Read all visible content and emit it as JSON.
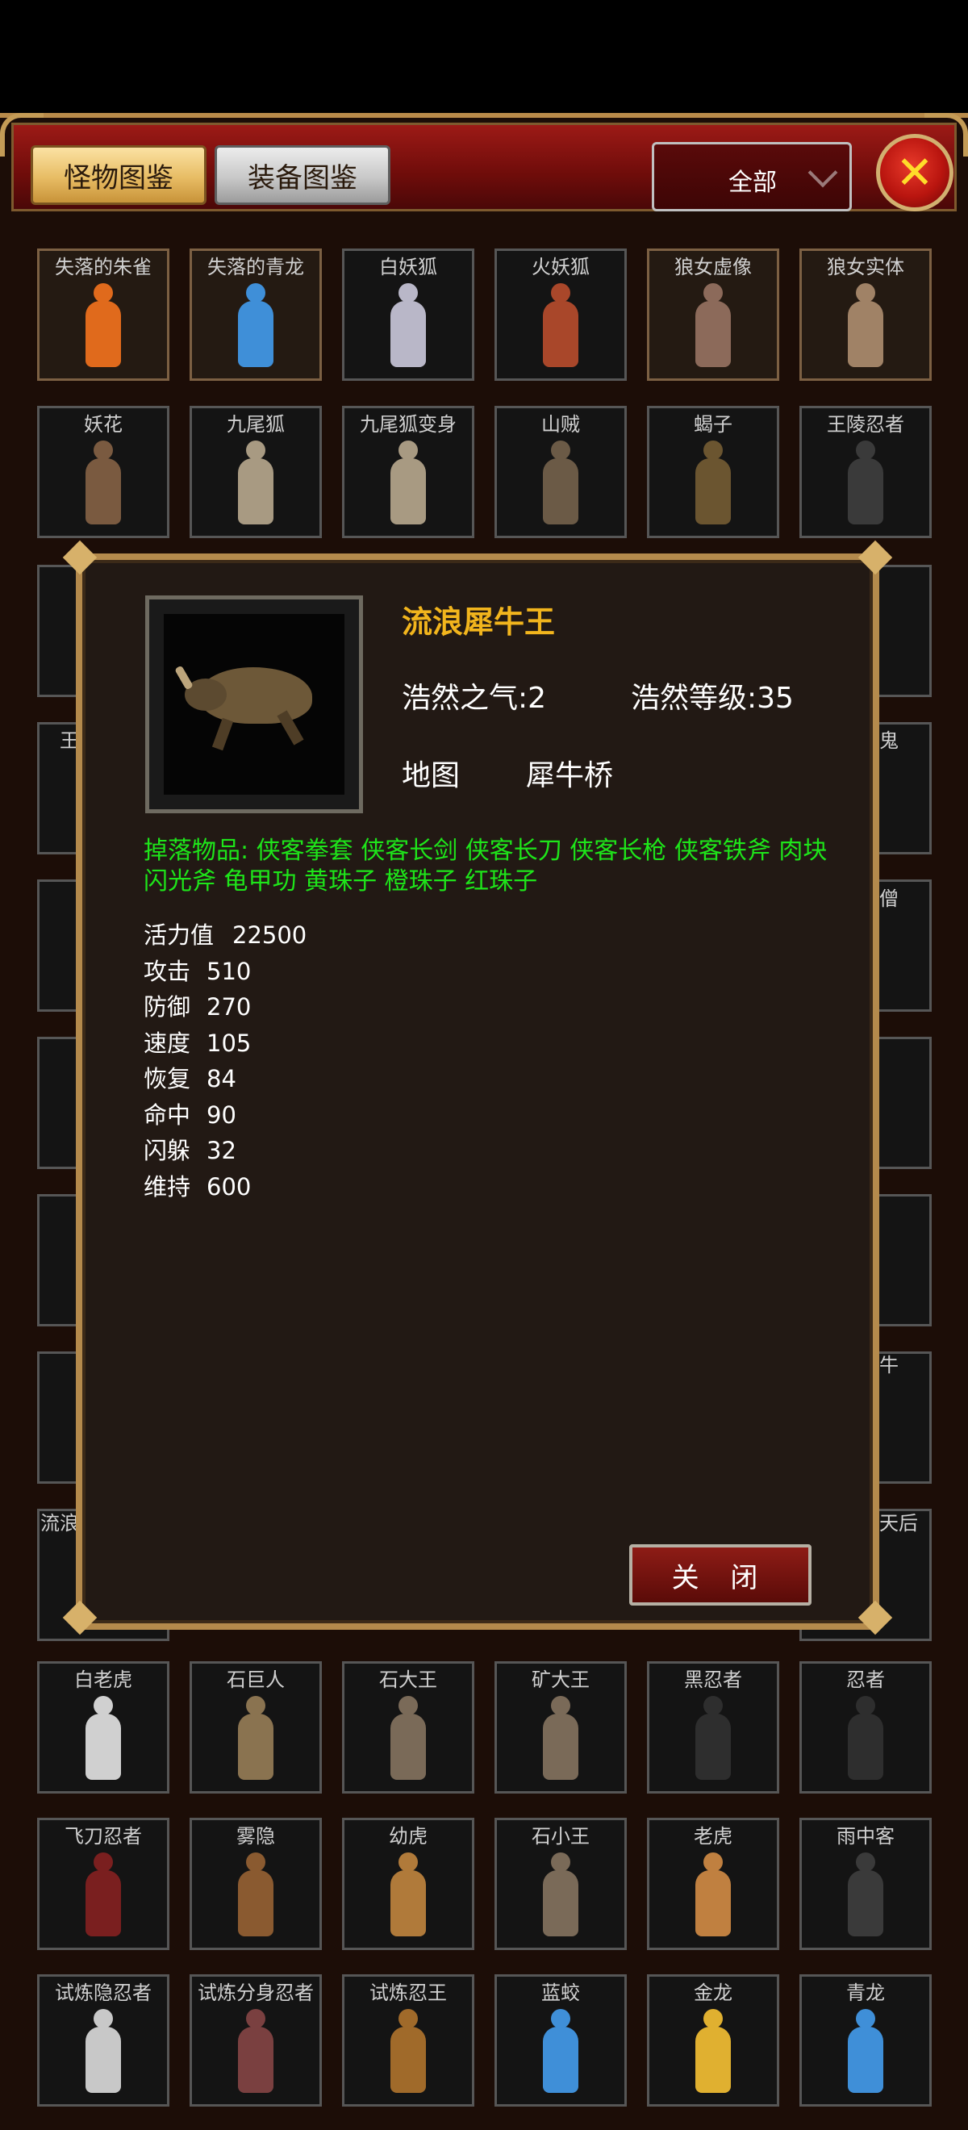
{
  "tabs": [
    {
      "label": "怪物图鉴",
      "active": true
    },
    {
      "label": "装备图鉴",
      "active": false
    }
  ],
  "filter": {
    "selected": "全部"
  },
  "close_icon": "close-x-icon",
  "monster_grid": [
    {
      "name": "失落的朱雀",
      "color": "#e06a1c"
    },
    {
      "name": "失落的青龙",
      "color": "#3f8fd8"
    },
    {
      "name": "白妖狐",
      "color": "#b9b7c8"
    },
    {
      "name": "火妖狐",
      "color": "#a9472a"
    },
    {
      "name": "狼女虚像",
      "color": "#8c6a5a"
    },
    {
      "name": "狼女实体",
      "color": "#a08266"
    },
    {
      "name": "妖花",
      "color": "#7a5a40"
    },
    {
      "name": "九尾狐",
      "color": "#a89a82"
    },
    {
      "name": "九尾狐变身",
      "color": "#a89a82"
    },
    {
      "name": "山贼",
      "color": "#6b5a46"
    },
    {
      "name": "蝎子",
      "color": "#6b5530"
    },
    {
      "name": "王陵忍者",
      "color": "#3a3a3a"
    },
    {
      "name": "白老虎",
      "color": "#d0d0d0"
    },
    {
      "name": "石巨人",
      "color": "#8a7350"
    },
    {
      "name": "石大王",
      "color": "#7a6a58"
    },
    {
      "name": "矿大王",
      "color": "#7a6a58"
    },
    {
      "name": "黑忍者",
      "color": "#2e2e2e"
    },
    {
      "name": "忍者",
      "color": "#2e2e2e"
    },
    {
      "name": "飞刀忍者",
      "color": "#7a1f1f"
    },
    {
      "name": "雾隐",
      "color": "#8a5a30"
    },
    {
      "name": "幼虎",
      "color": "#b07a3a"
    },
    {
      "name": "石小王",
      "color": "#7a6a58"
    },
    {
      "name": "老虎",
      "color": "#c08040"
    },
    {
      "name": "雨中客",
      "color": "#3a3a3a"
    },
    {
      "name": "试炼隐忍者",
      "color": "#c8c8c8"
    },
    {
      "name": "试炼分身忍者",
      "color": "#7a4040"
    },
    {
      "name": "试炼忍王",
      "color": "#a06a2a"
    },
    {
      "name": "蓝蛟",
      "color": "#3f8fd8"
    },
    {
      "name": "金龙",
      "color": "#e0b030"
    },
    {
      "name": "青龙",
      "color": "#3f8fd8"
    }
  ],
  "partial_grid_labels": [
    "王",
    "流浪",
    "鬼",
    "僧",
    "牛",
    "天后"
  ],
  "detail": {
    "name": "流浪犀牛王",
    "haoran_qi_label": "浩然之气:2",
    "haoran_level_label": "浩然等级:35",
    "map_label": "地图",
    "map_value": "犀牛桥",
    "drops_label": "掉落物品:",
    "drops": [
      "侠客拳套",
      "侠客长剑",
      "侠客长刀",
      "侠客长枪",
      "侠客铁斧",
      "肉块",
      "闪光斧",
      "龟甲功",
      "黄珠子",
      "橙珠子",
      "红珠子"
    ],
    "stats": [
      {
        "name": "活力值",
        "value": "22500"
      },
      {
        "name": "攻击",
        "value": "510"
      },
      {
        "name": "防御",
        "value": "270"
      },
      {
        "name": "速度",
        "value": "105"
      },
      {
        "name": "恢复",
        "value": "84"
      },
      {
        "name": "命中",
        "value": "90"
      },
      {
        "name": "闪躲",
        "value": "32"
      },
      {
        "name": "维持",
        "value": "600"
      }
    ],
    "close_label": "关 闭"
  }
}
